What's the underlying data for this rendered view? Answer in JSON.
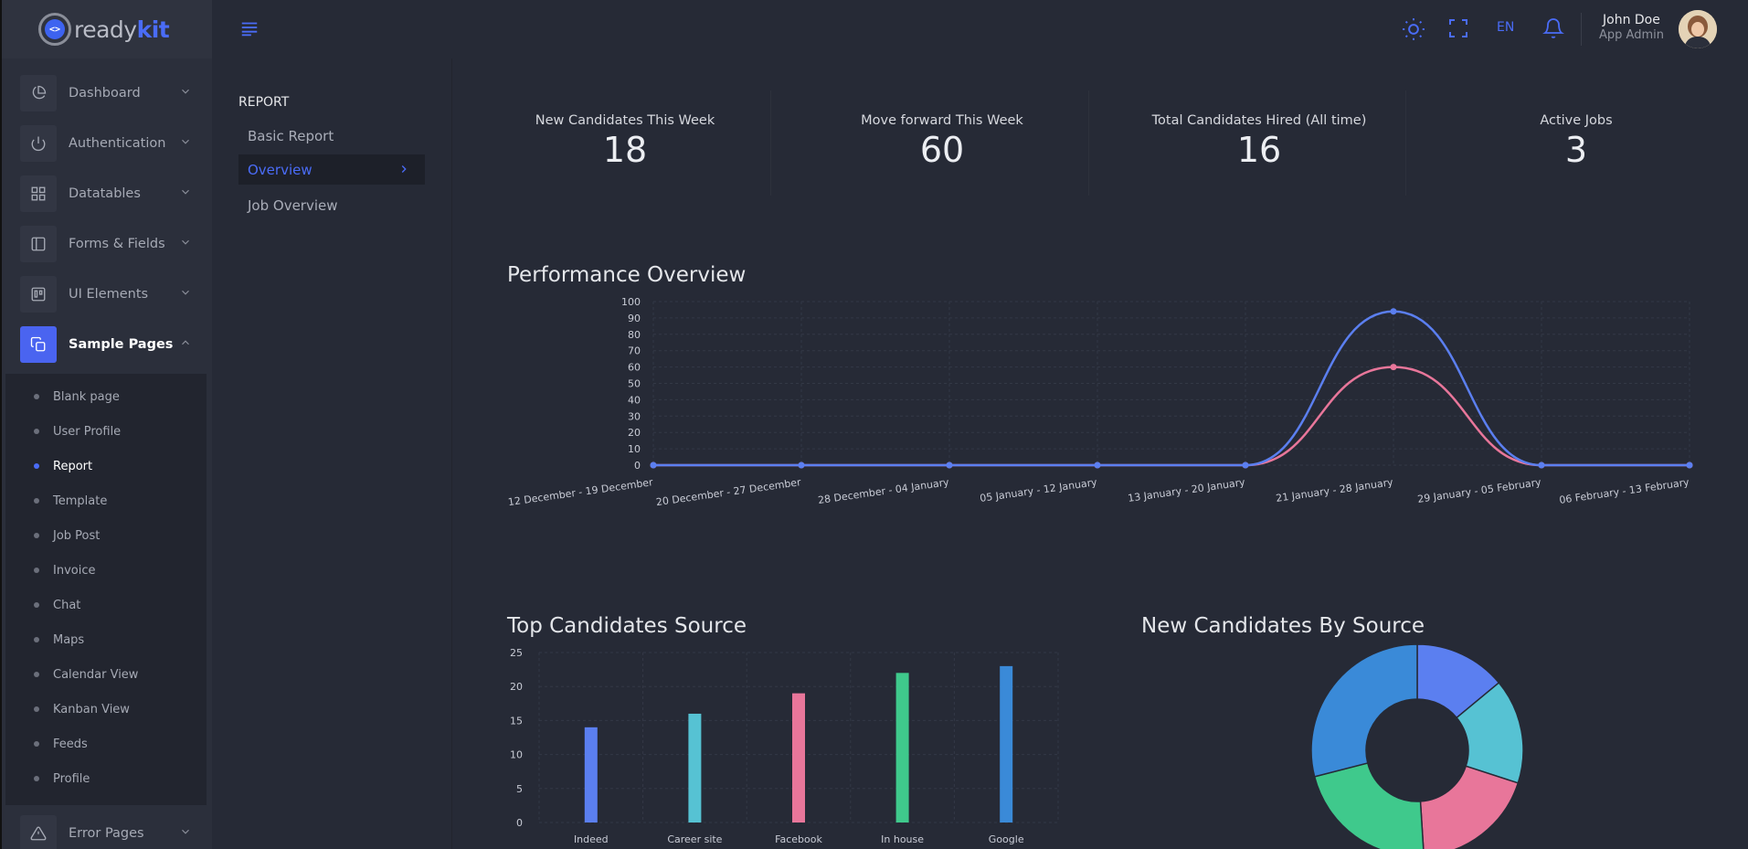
{
  "brand": {
    "part1": "ready",
    "part2": "kit",
    "logo_glyph": "<>"
  },
  "sidebar": {
    "items": [
      {
        "label": "Dashboard",
        "icon": "pie-chart-icon",
        "expanded": false
      },
      {
        "label": "Authentication",
        "icon": "power-icon",
        "expanded": false
      },
      {
        "label": "Datatables",
        "icon": "grid-icon",
        "expanded": false
      },
      {
        "label": "Forms & Fields",
        "icon": "sidebar-layout-icon",
        "expanded": false
      },
      {
        "label": "UI Elements",
        "icon": "trello-icon",
        "expanded": false
      },
      {
        "label": "Sample Pages",
        "icon": "copy-icon",
        "expanded": true,
        "active": true
      }
    ],
    "submenu": [
      "Blank page",
      "User Profile",
      "Report",
      "Template",
      "Job Post",
      "Invoice",
      "Chat",
      "Maps",
      "Calendar View",
      "Kanban View",
      "Feeds",
      "Profile"
    ],
    "submenu_active": "Report",
    "after": {
      "label": "Error Pages",
      "icon": "alert-triangle-icon"
    }
  },
  "topbar": {
    "lang": "EN",
    "user_name": "John Doe",
    "user_role": "App Admin"
  },
  "subpanel": {
    "title": "REPORT",
    "items": [
      "Basic Report",
      "Overview",
      "Job Overview"
    ],
    "active": "Overview"
  },
  "stats": [
    {
      "label": "New Candidates This Week",
      "value": "18"
    },
    {
      "label": "Move forward This Week",
      "value": "60"
    },
    {
      "label": "Total Candidates Hired (All time)",
      "value": "16"
    },
    {
      "label": "Active Jobs",
      "value": "3"
    }
  ],
  "sections": {
    "performance": "Performance Overview",
    "top_sources": "Top Candidates Source",
    "by_source": "New Candidates By Source"
  },
  "colors": {
    "accent": "#4a6cf7",
    "blue": "#5b7ff0",
    "pink": "#e8769a",
    "teal": "#56c2d3",
    "green": "#3fc98c",
    "dark_blue": "#3a8ad8"
  },
  "chart_data": [
    {
      "type": "line",
      "x": [
        "12 December - 19 December",
        "20 December - 27 December",
        "28 December - 04 January",
        "05 January - 12 January",
        "13 January - 20 January",
        "21 January - 28 January",
        "29 January - 05 February",
        "06 February - 13 February"
      ],
      "series": [
        {
          "values": [
            0,
            0,
            0,
            0,
            0,
            94,
            0,
            0
          ],
          "color": "#5b7ff0"
        },
        {
          "values": [
            0,
            0,
            0,
            0,
            0,
            60,
            0,
            0
          ],
          "color": "#e8769a"
        }
      ],
      "ylim": [
        0,
        100
      ],
      "yticks": [
        0,
        10,
        20,
        30,
        40,
        50,
        60,
        70,
        80,
        90,
        100
      ],
      "grid": true
    },
    {
      "type": "bar",
      "categories": [
        "Indeed",
        "Career site",
        "Facebook",
        "In house",
        "Google"
      ],
      "values": [
        14,
        16,
        19,
        22,
        23
      ],
      "colors": [
        "#5b7ff0",
        "#56c2d3",
        "#e8769a",
        "#3fc98c",
        "#3a8ad8"
      ],
      "ylim": [
        0,
        25
      ],
      "yticks": [
        0,
        5,
        10,
        15,
        20,
        25
      ],
      "grid": true
    },
    {
      "type": "pie",
      "donut": true,
      "values": [
        14,
        16,
        19,
        22,
        29
      ],
      "colors": [
        "#5b7ff0",
        "#56c2d3",
        "#e8769a",
        "#3fc98c",
        "#3a8ad8"
      ]
    }
  ]
}
